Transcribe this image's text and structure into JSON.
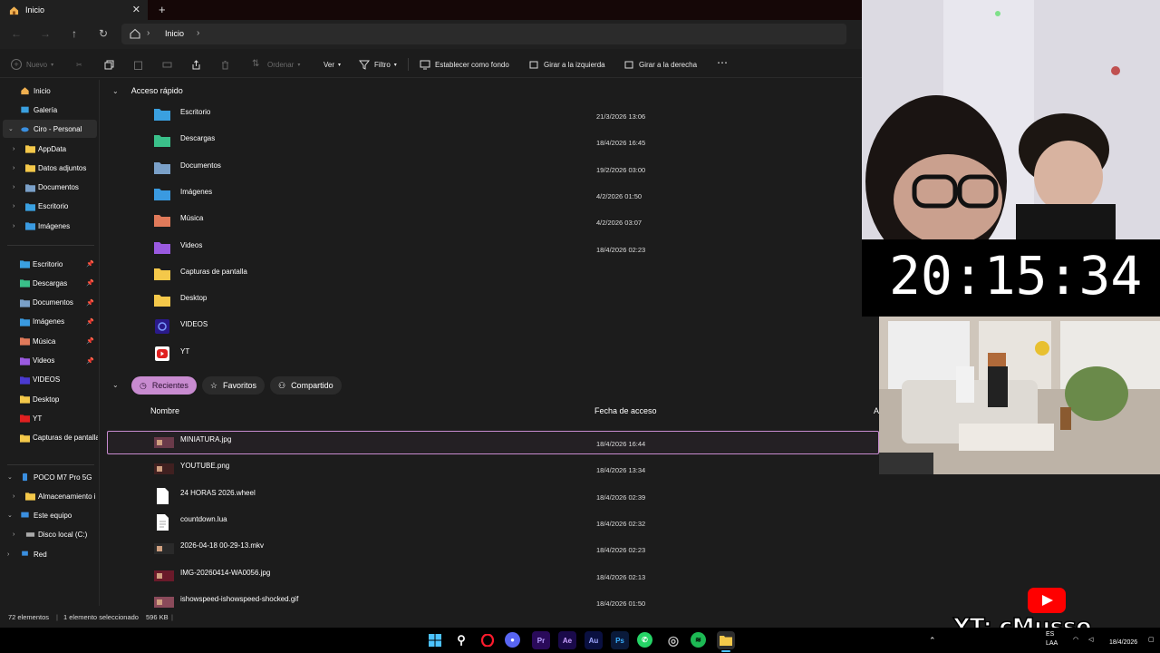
{
  "tab": {
    "title": "Inicio"
  },
  "address": {
    "crumb": "Inicio"
  },
  "commands": {
    "new": "Nuevo",
    "sort": "Ordenar",
    "view": "Ver",
    "filter": "Filtro",
    "set_background": "Establecer como fondo",
    "rotate_left": "Girar a la izquierda",
    "rotate_right": "Girar a la derecha"
  },
  "sidebar": {
    "home": "Inicio",
    "gallery": "Galería",
    "onedrive": "Ciro - Personal",
    "onedrive_children": [
      "AppData",
      "Datos adjuntos",
      "Documentos",
      "Escritorio",
      "Imágenes"
    ],
    "pinned": [
      {
        "label": "Escritorio",
        "pinned": true
      },
      {
        "label": "Descargas",
        "pinned": true
      },
      {
        "label": "Documentos",
        "pinned": true
      },
      {
        "label": "Imágenes",
        "pinned": true
      },
      {
        "label": "Música",
        "pinned": true
      },
      {
        "label": "Videos",
        "pinned": true
      },
      {
        "label": "VIDEOS",
        "pinned": false
      },
      {
        "label": "Desktop",
        "pinned": false
      },
      {
        "label": "YT",
        "pinned": false
      },
      {
        "label": "Capturas de pantalla",
        "pinned": false
      }
    ],
    "phone": "POCO M7 Pro 5G",
    "phone_child": "Almacenamiento i",
    "this_pc": "Este equipo",
    "local_disk": "Disco local (C:)",
    "network": "Red"
  },
  "quick_access": {
    "header": "Acceso rápido",
    "items": [
      {
        "name": "Escritorio",
        "date": "21/3/2026 13:06",
        "icon": "desktop-folder-icon"
      },
      {
        "name": "Descargas",
        "date": "18/4/2026 16:45",
        "icon": "downloads-folder-icon"
      },
      {
        "name": "Documentos",
        "date": "19/2/2026 03:00",
        "icon": "documents-folder-icon"
      },
      {
        "name": "Imágenes",
        "date": "4/2/2026 01:50",
        "icon": "pictures-folder-icon"
      },
      {
        "name": "Música",
        "date": "4/2/2026 03:07",
        "icon": "music-folder-icon"
      },
      {
        "name": "Videos",
        "date": "18/4/2026 02:23",
        "icon": "videos-folder-icon"
      },
      {
        "name": "Capturas de pantalla",
        "date": "",
        "icon": "folder-icon"
      },
      {
        "name": "Desktop",
        "date": "",
        "icon": "folder-icon"
      },
      {
        "name": "VIDEOS",
        "date": "",
        "icon": "videos-app-icon"
      },
      {
        "name": "YT",
        "date": "",
        "icon": "youtube-icon"
      }
    ]
  },
  "recent_tabs": {
    "recent": "Recientes",
    "favorites": "Favoritos",
    "shared": "Compartido"
  },
  "columns": {
    "name": "Nombre",
    "access_date": "Fecha de acceso",
    "third": "A"
  },
  "recent_files": [
    {
      "name": "MINIATURA.jpg",
      "date": "18/4/2026 16:44",
      "selected": true
    },
    {
      "name": "YOUTUBE.png",
      "date": "18/4/2026 13:34",
      "selected": false
    },
    {
      "name": "24 HORAS 2026.wheel",
      "date": "18/4/2026 02:39",
      "selected": false
    },
    {
      "name": "countdown.lua",
      "date": "18/4/2026 02:32",
      "selected": false
    },
    {
      "name": "2026-04-18 00-29-13.mkv",
      "date": "18/4/2026 02:23",
      "selected": false
    },
    {
      "name": "IMG-20260414-WA0056.jpg",
      "date": "18/4/2026 02:13",
      "selected": false
    },
    {
      "name": "ishowspeed-ishowspeed-shocked.gif",
      "date": "18/4/2026 01:50",
      "selected": false
    }
  ],
  "status": {
    "count": "72 elementos",
    "selection": "1 elemento seleccionado",
    "size": "596 KB"
  },
  "overlay": {
    "clock": "20:15:34",
    "watermark": "YT: cMusso"
  },
  "tray": {
    "lang": "ES",
    "layout": "LAA",
    "date": "18/4/2026"
  },
  "colors": {
    "accent": "#c88bd0",
    "background": "#1c1c1c",
    "folder": "#f4c84a"
  }
}
